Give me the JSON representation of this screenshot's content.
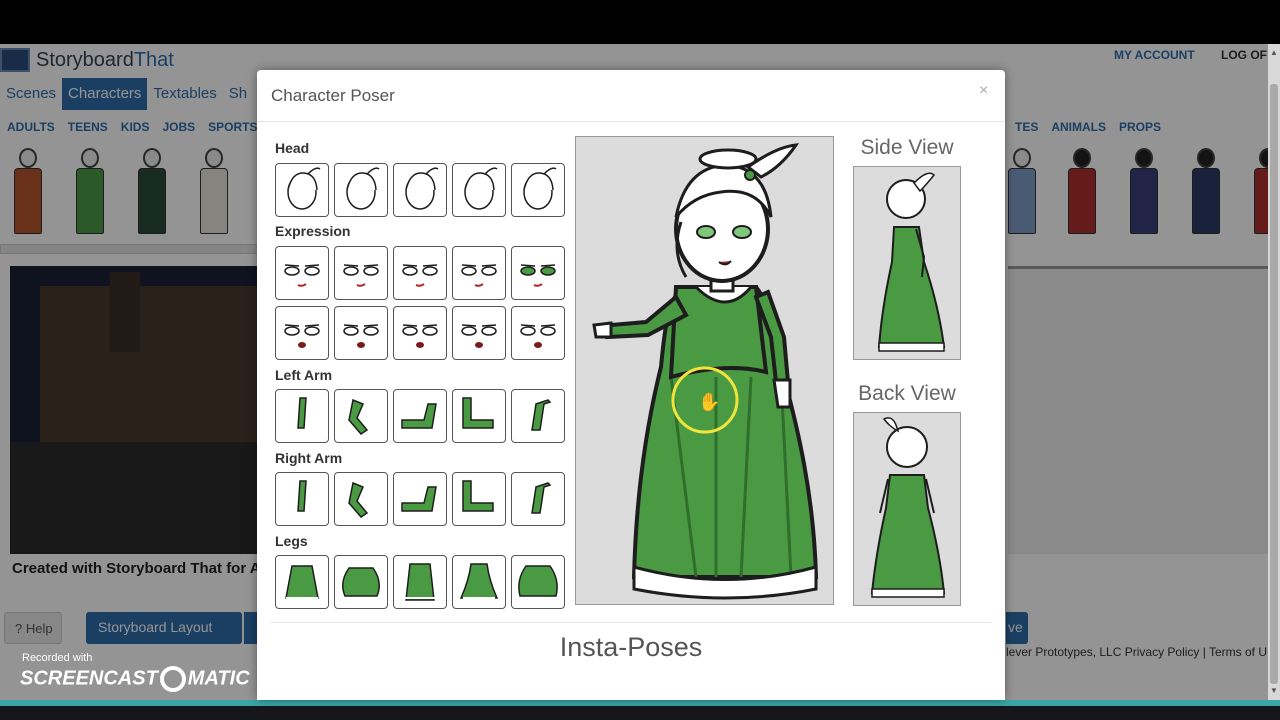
{
  "app": {
    "logo_prefix": "Storyboard",
    "logo_suffix": "That",
    "my_account": "MY ACCOUNT",
    "log_off": "LOG OF"
  },
  "tabs": [
    "Scenes",
    "Characters",
    "Textables",
    "Sh"
  ],
  "categories_left": [
    "ADULTS",
    "TEENS",
    "KIDS",
    "JOBS",
    "SPORTS"
  ],
  "categories_right": [
    "TES",
    "ANIMALS",
    "PROPS"
  ],
  "canvas_caption": "Created with Storyboard That for A",
  "buttons": {
    "help": "? Help",
    "storyboard_layout": "Storyboard Layout",
    "save_fragment": "ve"
  },
  "footer": "lever Prototypes, LLC  Privacy Policy | Terms of U",
  "recorder": {
    "recorded_with": "Recorded with",
    "brand_left": "SCREENCAST",
    "brand_right": "MATIC"
  },
  "modal": {
    "title": "Character Poser",
    "close": "×",
    "sections": {
      "head": "Head",
      "expression": "Expression",
      "left_arm": "Left Arm",
      "right_arm": "Right Arm",
      "legs": "Legs"
    },
    "side_view": "Side View",
    "back_view": "Back View",
    "insta_poses": "Insta-Poses"
  },
  "colors": {
    "brand_blue": "#2f6dab",
    "dress_green": "#4a9a44",
    "dress_green_dark": "#2f6e2c",
    "teal_bar": "#3aa6a6"
  }
}
